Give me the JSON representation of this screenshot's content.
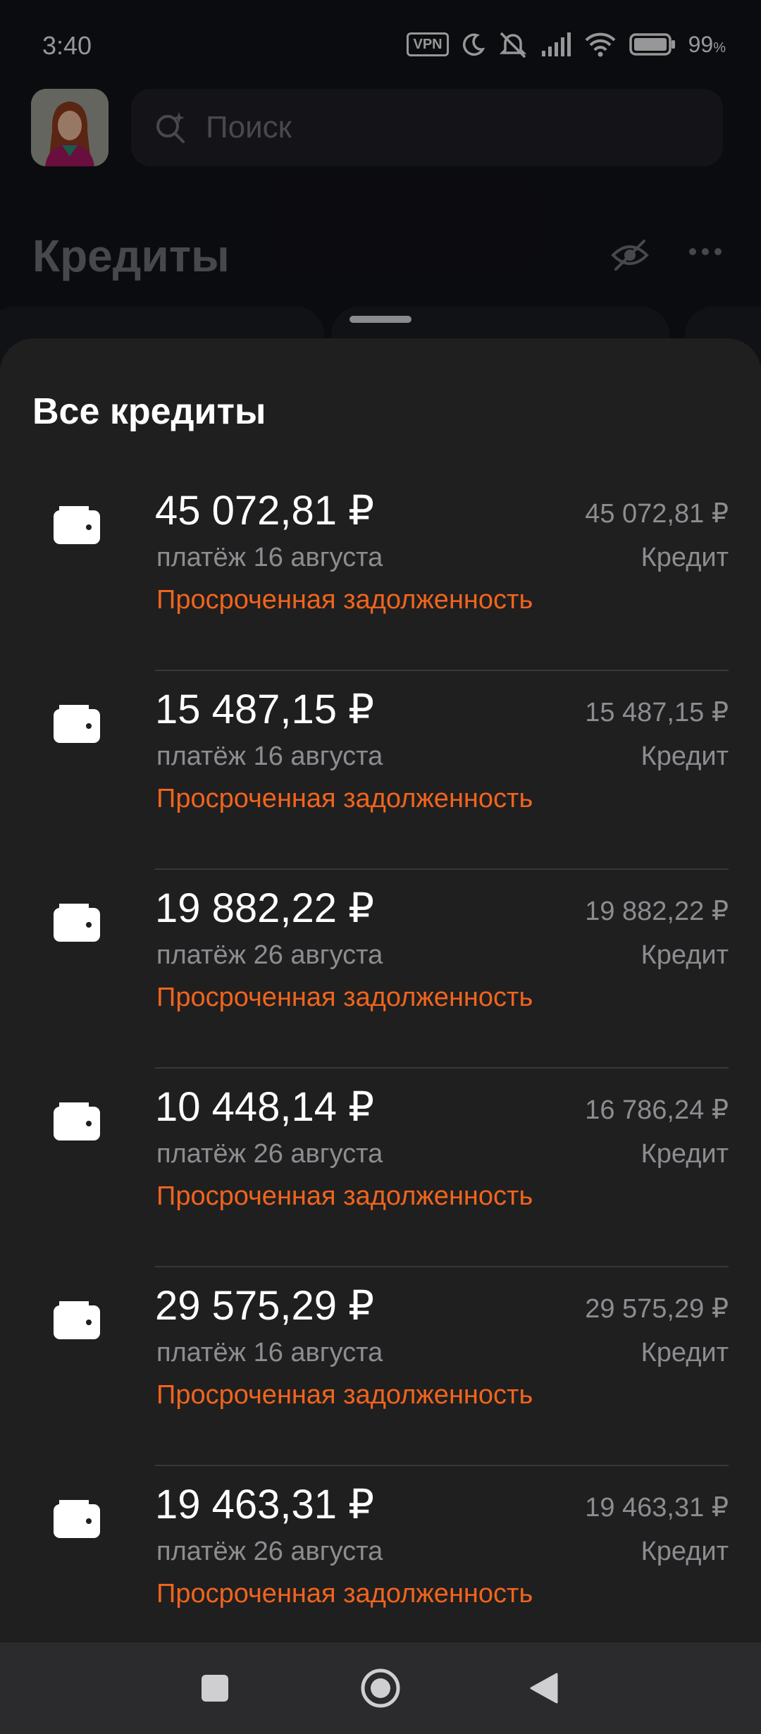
{
  "status_bar": {
    "time": "3:40",
    "vpn": "VPN",
    "battery_percent": "99",
    "battery_unit": "%",
    "icons": [
      "vpn-icon",
      "moon-icon",
      "mute-icon",
      "signal-icon",
      "wifi-icon",
      "battery-icon"
    ]
  },
  "header": {
    "search_placeholder": "Поиск",
    "title": "Кредиты"
  },
  "sheet": {
    "title": "Все кредиты",
    "items": [
      {
        "amount": "45 072,81 ₽",
        "date": "платёж 16 августа",
        "status": "Просроченная задолженность",
        "total": "45 072,81 ₽",
        "type": "Кредит"
      },
      {
        "amount": "15 487,15 ₽",
        "date": "платёж 16 августа",
        "status": "Просроченная задолженность",
        "total": "15 487,15 ₽",
        "type": "Кредит"
      },
      {
        "amount": "19 882,22 ₽",
        "date": "платёж 26 августа",
        "status": "Просроченная задолженность",
        "total": "19 882,22 ₽",
        "type": "Кредит"
      },
      {
        "amount": "10 448,14 ₽",
        "date": "платёж 26 августа",
        "status": "Просроченная задолженность",
        "total": "16 786,24 ₽",
        "type": "Кредит"
      },
      {
        "amount": "29 575,29 ₽",
        "date": "платёж 16 августа",
        "status": "Просроченная задолженность",
        "total": "29 575,29 ₽",
        "type": "Кредит"
      },
      {
        "amount": "19 463,31 ₽",
        "date": "платёж 26 августа",
        "status": "Просроченная задолженность",
        "total": "19 463,31 ₽",
        "type": "Кредит"
      }
    ]
  },
  "colors": {
    "accent_overdue": "#f0641e",
    "sheet_bg": "#1f1f1f",
    "muted_text": "#8c8d91"
  },
  "nav": {
    "icons": [
      "recents-square-icon",
      "home-circle-icon",
      "back-triangle-icon"
    ]
  }
}
